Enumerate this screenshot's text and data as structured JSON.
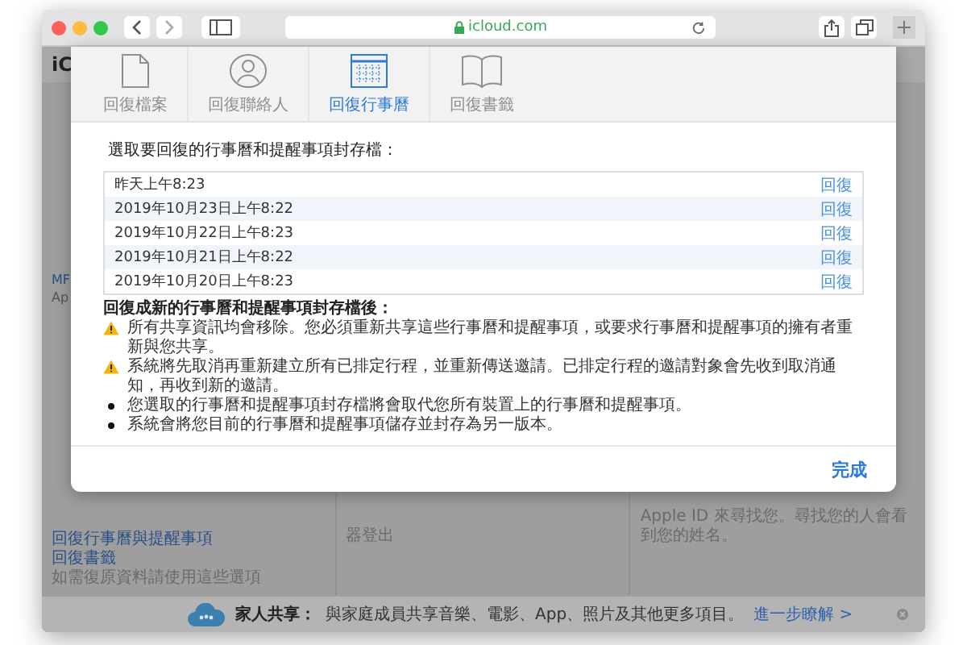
{
  "browser": {
    "address": "icloud.com"
  },
  "page": {
    "logo": "iC",
    "fragments": [
      "MF",
      "Ap"
    ],
    "links": [
      "回復行事曆與提醒事項",
      "回復書籤"
    ],
    "hint": "如需復原資料請使用這些選項",
    "column_2": "器登出",
    "column_3": "Apple ID 來尋找您。尋找您的人會看到您的姓名。"
  },
  "dialog": {
    "tabs": [
      {
        "label": "回復檔案",
        "kind": "document",
        "selected": false
      },
      {
        "label": "回復聯絡人",
        "kind": "contacts",
        "selected": false
      },
      {
        "label": "回復行事曆",
        "kind": "calendar",
        "selected": true
      },
      {
        "label": "回復書籤",
        "kind": "bookmarks",
        "selected": false
      }
    ],
    "heading": "選取要回復的行事曆和提醒事項封存檔：",
    "archives": [
      {
        "date": "昨天上午8:23",
        "action": "回復"
      },
      {
        "date": "2019年10月23日上午8:22",
        "action": "回復"
      },
      {
        "date": "2019年10月22日上午8:23",
        "action": "回復"
      },
      {
        "date": "2019年10月21日上午8:22",
        "action": "回復"
      },
      {
        "date": "2019年10月20日上午8:23",
        "action": "回復"
      }
    ],
    "notes_title": "回復成新的行事曆和提醒事項封存檔後：",
    "notes": [
      {
        "kind": "warning",
        "text": "所有共享資訊均會移除。您必須重新共享這些行事曆和提醒事項，或要求行事曆和提醒事項的擁有者重新與您共享。"
      },
      {
        "kind": "warning",
        "text": "系統將先取消再重新建立所有已排定行程，並重新傳送邀請。已排定行程的邀請對象會先收到取消通知，再收到新的邀請。"
      },
      {
        "kind": "bullet",
        "text": "您選取的行事曆和提醒事項封存檔將會取代您所有裝置上的行事曆和提醒事項。"
      },
      {
        "kind": "bullet",
        "text": "系統會將您目前的行事曆和提醒事項儲存並封存為另一版本。"
      }
    ],
    "done": "完成"
  },
  "family_bar": {
    "title": "家人共享：",
    "text": "與家庭成員共享音樂、電影、App、照片及其他更多項目。",
    "link": "進一步瞭解 >"
  }
}
